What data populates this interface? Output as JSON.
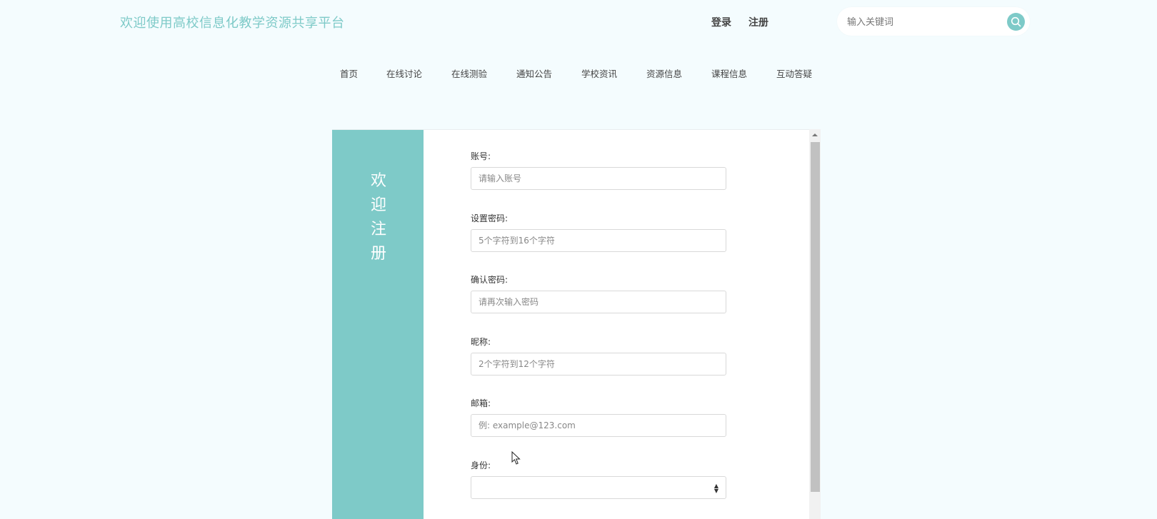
{
  "header": {
    "site_title": "欢迎使用高校信息化教学资源共享平台",
    "login": "登录",
    "register": "注册",
    "search": {
      "placeholder": "输入关键词"
    }
  },
  "nav": {
    "items": [
      "首页",
      "在线讨论",
      "在线测验",
      "通知公告",
      "学校资讯",
      "资源信息",
      "课程信息",
      "互动答疑"
    ]
  },
  "register_form": {
    "side_title": "欢迎注册",
    "fields": {
      "account": {
        "label": "账号:",
        "placeholder": "请输入账号"
      },
      "password": {
        "label": "设置密码:",
        "placeholder": "5个字符到16个字符"
      },
      "confirm_password": {
        "label": "确认密码:",
        "placeholder": "请再次输入密码"
      },
      "nickname": {
        "label": "昵称:",
        "placeholder": "2个字符到12个字符"
      },
      "email": {
        "label": "邮箱:",
        "placeholder": "例: example@123.com"
      },
      "identity": {
        "label": "身份:",
        "value": ""
      }
    }
  },
  "colors": {
    "accent": "#7ecac8",
    "background": "#f4fcfe"
  },
  "icons": {
    "search": "search-icon",
    "select_arrows": "sort-arrows-icon",
    "cursor": "mouse-pointer-icon"
  }
}
